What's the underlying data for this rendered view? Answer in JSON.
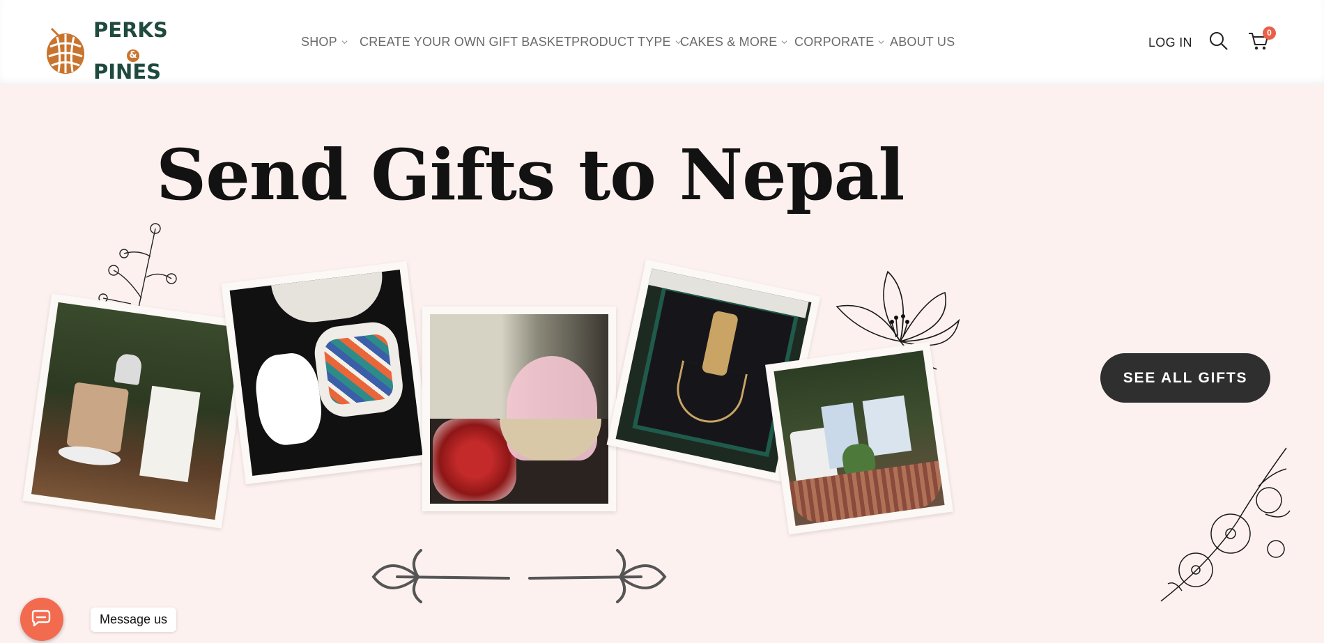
{
  "header": {
    "logo": {
      "line1": "PERKS",
      "amp": "&",
      "line2": "PINES"
    },
    "nav": [
      {
        "label": "SHOP",
        "dropdown": true
      },
      {
        "label": "CREATE YOUR OWN GIFT BASKET",
        "dropdown": false
      },
      {
        "label": "PRODUCT TYPE",
        "dropdown": true
      },
      {
        "label": "CAKES & MORE",
        "dropdown": true
      },
      {
        "label": "CORPORATE",
        "dropdown": true
      },
      {
        "label": "ABOUT US",
        "dropdown": false
      }
    ],
    "login": "LOG IN",
    "search_icon": "search-icon",
    "cart_icon": "cart-icon",
    "cart_count": "0"
  },
  "hero": {
    "headline": "Send Gifts to Nepal",
    "photos": [
      {
        "alt": "candle and birthday chocolate gift"
      },
      {
        "alt": "handwoven dhaka fabric box"
      },
      {
        "alt": "roses and pink wrapped gift basket"
      },
      {
        "alt": "gold pendant necklace in box"
      },
      {
        "alt": "mug, succulent and cards gift basket"
      }
    ],
    "cta": "SEE ALL GIFTS"
  },
  "chat": {
    "label": "Message us",
    "icon": "chat-bubble-icon"
  },
  "colors": {
    "brand_green": "#1f4a3e",
    "brand_orange": "#c9742e",
    "hero_bg": "#fdf1f0",
    "cta_bg": "#2f2f2f",
    "badge": "#ea5f47",
    "chat": "#f26b4f"
  }
}
